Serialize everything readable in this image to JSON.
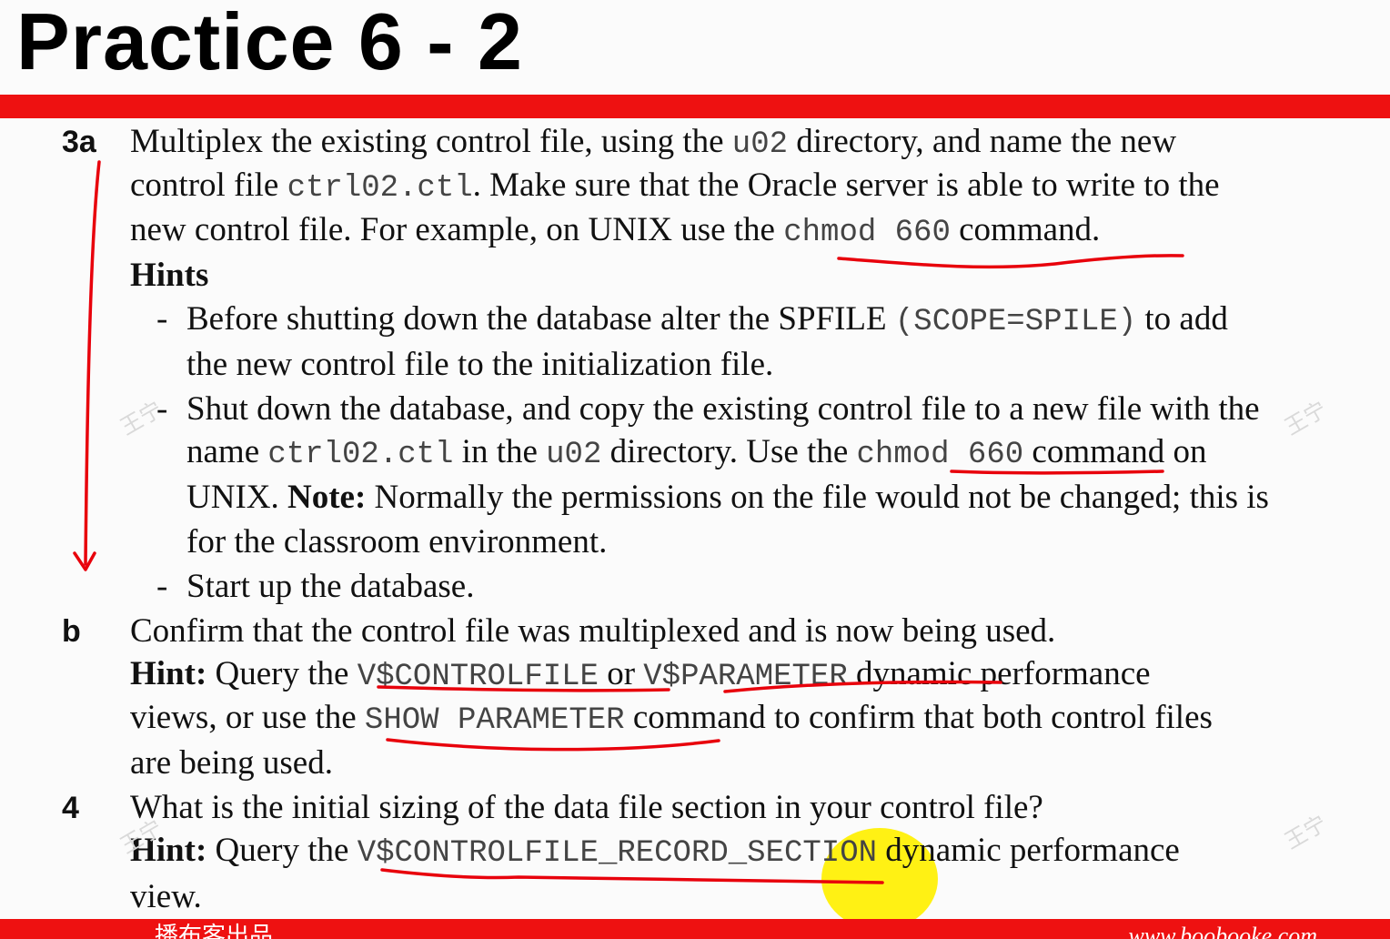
{
  "slide": {
    "title": "Practice 6 - 2"
  },
  "q3a": {
    "number": "3a",
    "line1_a": "Multiplex the existing control file, using the ",
    "line1_code": "u02",
    "line1_b": " directory, and name the new",
    "line2_a": "control file ",
    "line2_code": "ctrl02.ctl",
    "line2_b": ". Make sure that the Oracle server is able to write to the",
    "line3_a": "new control file. For example, on UNIX use the ",
    "line3_code": "chmod 660",
    "line3_b": " command.",
    "hints_label": "Hints",
    "hint1_line1_a": "Before shutting down the database alter the SPFILE ",
    "hint1_line1_code": "(SCOPE=SPILE)",
    "hint1_line1_b": " to add",
    "hint1_line2": "the new control file to the initialization file.",
    "hint2_line1": "Shut down the database, and copy the existing control file to a new file with the",
    "hint2_line2_a": "name ",
    "hint2_line2_code1": "ctrl02.ctl",
    "hint2_line2_b": " in the ",
    "hint2_line2_code2": "u02",
    "hint2_line2_c": " directory. Use the ",
    "hint2_line2_code3": "chmod 660",
    "hint2_line2_d": " command on",
    "hint2_line3_a": "UNIX.  ",
    "hint2_line3_note": "Note:",
    "hint2_line3_b": " Normally the permissions on the file would not be changed; this is",
    "hint2_line4": "for the classroom environment.",
    "hint3": "Start up the database.",
    "dash": "-"
  },
  "qb": {
    "number": "b",
    "line1": "Confirm that the control file was multiplexed and is now being used.",
    "hint_label": "Hint:",
    "line2_a": " Query the ",
    "line2_code1": "V$CONTROLFILE",
    "line2_b": " or ",
    "line2_code2": "V$PARAMETER",
    "line2_c": " dynamic performance",
    "line3_a": "views, or use the ",
    "line3_code": "SHOW PARAMETER",
    "line3_b": " command to confirm that both control files",
    "line4": "are being used."
  },
  "q4": {
    "number": "4",
    "line1": "What is the initial sizing of the data file section in your control file?",
    "hint_label": "Hint:",
    "line2_a": " Query the ",
    "line2_code": "V$CONTROLFILE_RECORD_SECTION",
    "line2_b": " dynamic performance",
    "line3": "view."
  },
  "footer": {
    "left": "播布客出品",
    "right": "www.boobooke.com"
  },
  "watermark": "王宁",
  "colors": {
    "bar": "#ee1111",
    "annotation": "#e8000b",
    "highlight": "#fff000"
  }
}
